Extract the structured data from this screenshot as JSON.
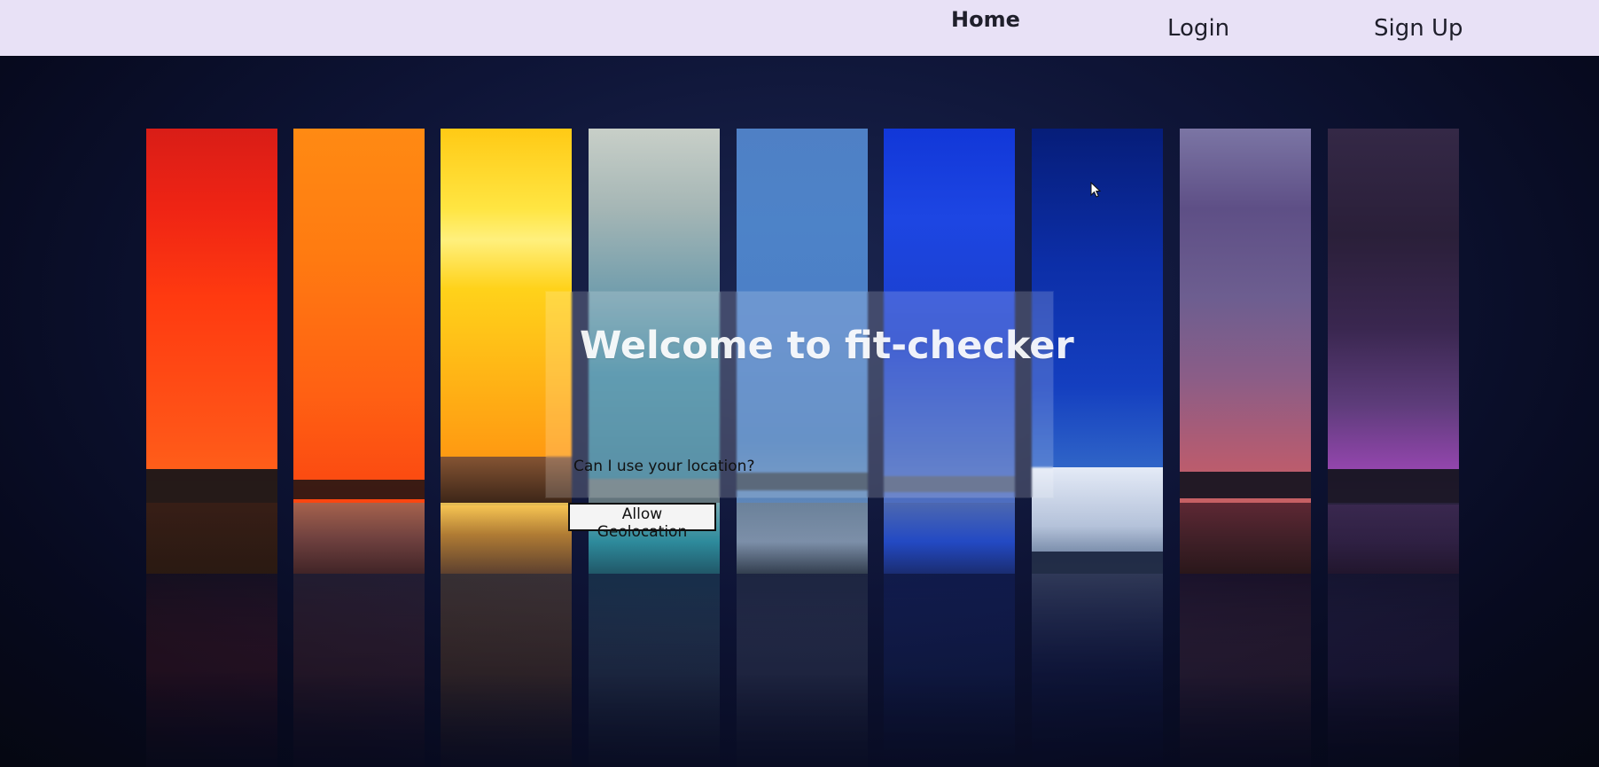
{
  "nav": {
    "home": "Home",
    "login": "Login",
    "signup": "Sign Up"
  },
  "hero": {
    "headline": "Welcome to fit-checker",
    "prompt": "Can I use your location?",
    "button_label": "Allow Geolocation"
  },
  "colors": {
    "nav_background": "#e8e1f6",
    "nav_text": "#1f1f2b",
    "page_background": "#070a1f",
    "headline_text": "#ffffff",
    "button_border": "#0f0f0f"
  },
  "icons": {
    "cursor": "mouse-pointer-icon"
  }
}
